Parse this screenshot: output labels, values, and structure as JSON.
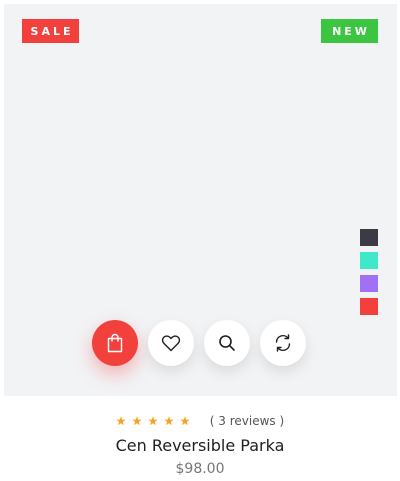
{
  "badges": {
    "sale": "SALE",
    "new": "NEW"
  },
  "colors": {
    "sale_badge": "#f2413d",
    "new_badge": "#3cc540",
    "primary_button": "#f2413d",
    "star": "#f5a623"
  },
  "swatches": [
    {
      "color": "#3b3a45"
    },
    {
      "color": "#3ee8c8"
    },
    {
      "color": "#a071f5"
    },
    {
      "color": "#f2413d"
    }
  ],
  "actions": [
    {
      "icon": "shopping-bag-icon"
    },
    {
      "icon": "heart-icon"
    },
    {
      "icon": "search-icon"
    },
    {
      "icon": "refresh-icon"
    }
  ],
  "product": {
    "rating": 5,
    "reviews": "( 3 reviews )",
    "title": "Cen Reversible Parka",
    "price": "$98.00"
  }
}
